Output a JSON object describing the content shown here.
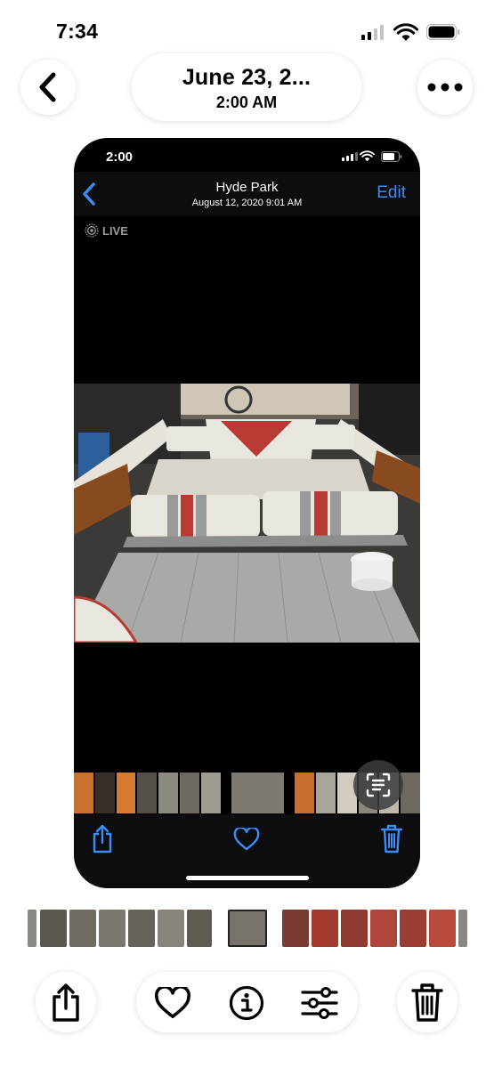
{
  "status_bar": {
    "time": "7:34"
  },
  "header": {
    "date": "June 23, 2...",
    "time": "2:00 AM"
  },
  "inner_screenshot": {
    "status_time": "2:00",
    "album_title": "Hyde Park",
    "date_time": "August 12, 2020  9:01 AM",
    "edit_label": "Edit",
    "live_label": "LIVE"
  },
  "colors": {
    "ios_blue": "#3b8cf5",
    "seat_red": "#b83a32",
    "seat_white": "#e9e6e0",
    "deck_gray": "#a9a9a6"
  },
  "icons": {
    "back": "chevron-left-icon",
    "more": "ellipsis-icon",
    "share": "share-icon",
    "favorite": "heart-icon",
    "info": "info-icon",
    "adjust": "sliders-icon",
    "delete": "trash-icon",
    "live_text": "text-scan-icon"
  }
}
